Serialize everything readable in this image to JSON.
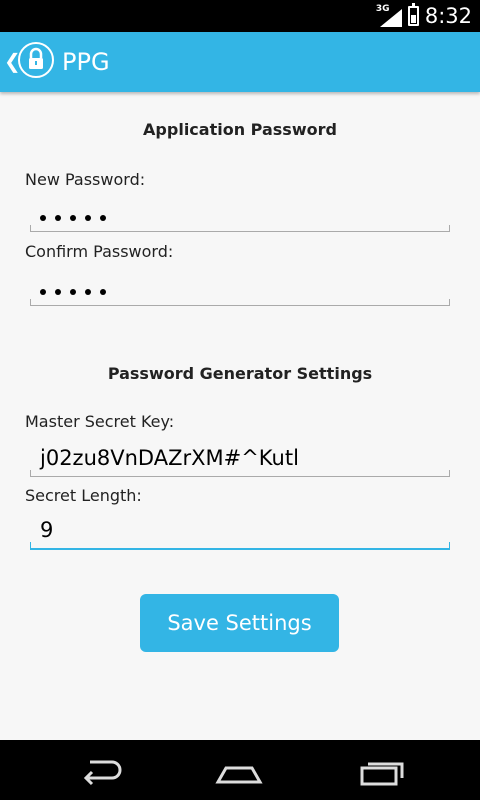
{
  "status_bar": {
    "network": "3G",
    "time": "8:32"
  },
  "action_bar": {
    "title": "PPG"
  },
  "app_password": {
    "section_title": "Application Password",
    "new_password_label": "New Password:",
    "new_password_mask_count": 5,
    "confirm_password_label": "Confirm Password:",
    "confirm_password_mask_count": 5
  },
  "generator_settings": {
    "section_title": "Password Generator Settings",
    "master_key_label": "Master Secret Key:",
    "master_key_value": "j02zu8VnDAZrXM#^Kutl",
    "secret_length_label": "Secret Length:",
    "secret_length_value": "9"
  },
  "actions": {
    "save_label": "Save Settings"
  },
  "colors": {
    "accent": "#33b5e5",
    "background": "#f7f7f7"
  }
}
